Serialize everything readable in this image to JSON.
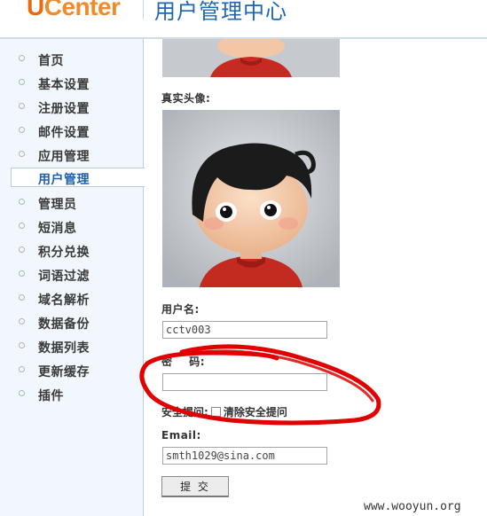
{
  "header": {
    "logo_u": "U",
    "logo_rest": "Center",
    "title": "用户管理中心"
  },
  "sidebar": {
    "items": [
      {
        "label": "首页",
        "active": false
      },
      {
        "label": "基本设置",
        "active": false
      },
      {
        "label": "注册设置",
        "active": false
      },
      {
        "label": "邮件设置",
        "active": false
      },
      {
        "label": "应用管理",
        "active": false
      },
      {
        "label": "用户管理",
        "active": true
      },
      {
        "label": "管理员",
        "active": false
      },
      {
        "label": "短消息",
        "active": false
      },
      {
        "label": "积分兑换",
        "active": false
      },
      {
        "label": "词语过滤",
        "active": false
      },
      {
        "label": "域名解析",
        "active": false
      },
      {
        "label": "数据备份",
        "active": false
      },
      {
        "label": "数据列表",
        "active": false
      },
      {
        "label": "更新缓存",
        "active": false
      },
      {
        "label": "插件",
        "active": false
      }
    ]
  },
  "form": {
    "avatar_label": "真实头像:",
    "username_label": "用户名:",
    "username_value": "cctv003",
    "password_label": "密    码:",
    "password_value": "",
    "security_hint_label": "安全提问:",
    "security_hint_clear": "清除安全提问",
    "email_label": "Email:",
    "email_value": "smth1029@sina.com",
    "submit_label": "提 交"
  },
  "annotation": {
    "color": "#e00000",
    "shape": "hand-drawn-circle-around-password"
  },
  "watermark": "www.wooyun.org"
}
